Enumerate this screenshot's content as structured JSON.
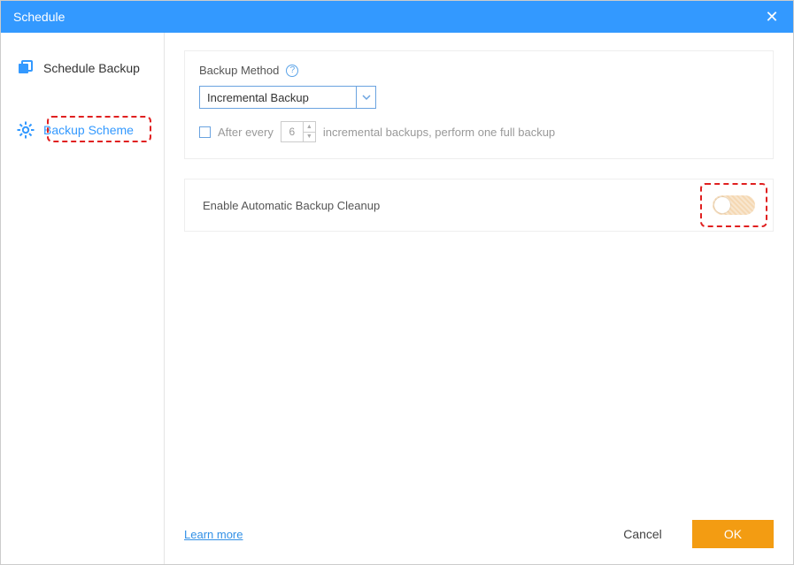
{
  "titlebar": {
    "title": "Schedule"
  },
  "sidebar": {
    "items": [
      {
        "label": "Schedule Backup"
      },
      {
        "label": "Backup Scheme"
      }
    ]
  },
  "backup_method": {
    "section_label": "Backup Method",
    "dropdown_value": "Incremental Backup",
    "after_every_label": "After every",
    "after_every_value": "6",
    "after_every_suffix": "incremental backups, perform one full backup"
  },
  "cleanup": {
    "label": "Enable Automatic Backup Cleanup"
  },
  "footer": {
    "learn_more": "Learn more",
    "cancel": "Cancel",
    "ok": "OK"
  }
}
